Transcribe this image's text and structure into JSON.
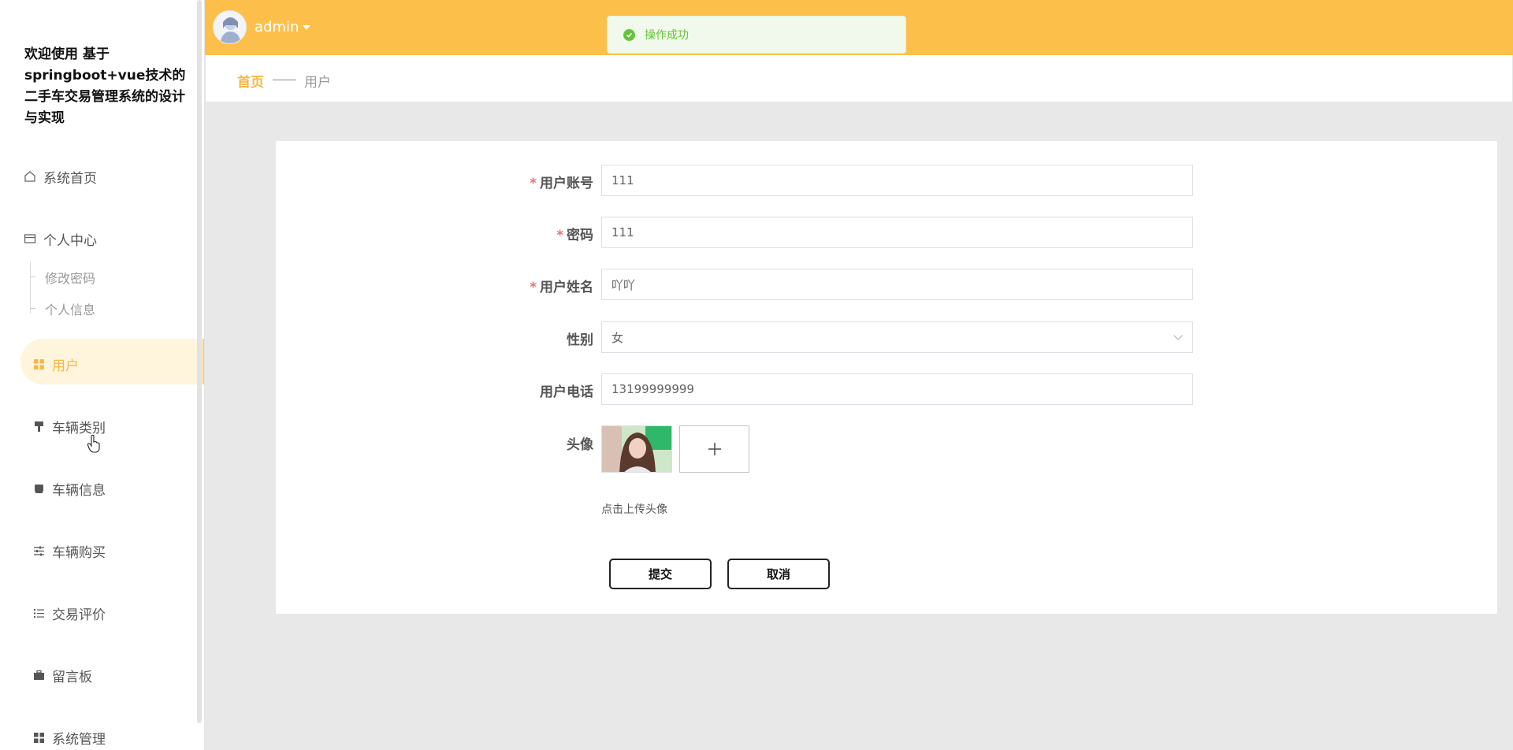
{
  "sidebar": {
    "brand": "欢迎使用 基于springboot+vue技术的二手车交易管理系统的设计与实现",
    "items": [
      {
        "label": "系统首页",
        "icon": "home-icon"
      },
      {
        "label": "个人中心",
        "icon": "card-icon"
      },
      {
        "label": "修改密码"
      },
      {
        "label": "个人信息"
      },
      {
        "label": "用户",
        "icon": "grid-icon"
      },
      {
        "label": "车辆类别",
        "icon": "brush-icon"
      },
      {
        "label": "车辆信息",
        "icon": "box-icon"
      },
      {
        "label": "车辆购买",
        "icon": "sliders-icon"
      },
      {
        "label": "交易评价",
        "icon": "list-icon"
      },
      {
        "label": "留言板",
        "icon": "briefcase-icon"
      },
      {
        "label": "系统管理",
        "icon": "grid-icon"
      }
    ]
  },
  "header": {
    "username": "admin"
  },
  "toast": {
    "message": "操作成功"
  },
  "breadcrumb": {
    "home": "首页",
    "current": "用户"
  },
  "form": {
    "account": {
      "label": "用户账号",
      "value": "111",
      "required": true
    },
    "password": {
      "label": "密码",
      "value": "111",
      "required": true
    },
    "name": {
      "label": "用户姓名",
      "value": "吖吖",
      "required": true
    },
    "gender": {
      "label": "性别",
      "value": "女"
    },
    "phone": {
      "label": "用户电话",
      "value": "13199999999"
    },
    "avatar": {
      "label": "头像",
      "tip": "点击上传头像"
    },
    "submit": "提交",
    "cancel": "取消"
  },
  "colors": {
    "accent": "#fcc04a",
    "active_text": "#f7b843",
    "required": "#f56c6c",
    "success": "#67c23a"
  }
}
